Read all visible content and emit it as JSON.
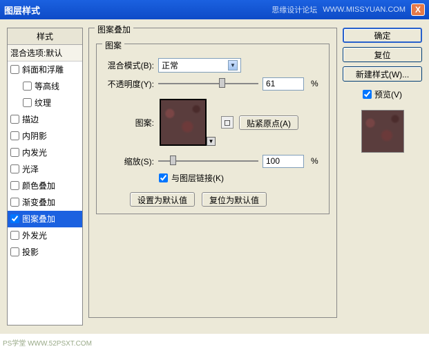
{
  "titlebar": {
    "title": "图层样式",
    "watermark1": "思缘设计论坛",
    "watermark2": "WWW.MISSYUAN.COM",
    "close": "X"
  },
  "styles_panel": {
    "header": "样式",
    "sub": "混合选项:默认",
    "items": [
      {
        "label": "斜面和浮雕",
        "checked": false,
        "indent": false
      },
      {
        "label": "等高线",
        "checked": false,
        "indent": true
      },
      {
        "label": "纹理",
        "checked": false,
        "indent": true
      },
      {
        "label": "描边",
        "checked": false,
        "indent": false
      },
      {
        "label": "内阴影",
        "checked": false,
        "indent": false
      },
      {
        "label": "内发光",
        "checked": false,
        "indent": false
      },
      {
        "label": "光泽",
        "checked": false,
        "indent": false
      },
      {
        "label": "颜色叠加",
        "checked": false,
        "indent": false
      },
      {
        "label": "渐变叠加",
        "checked": false,
        "indent": false
      },
      {
        "label": "图案叠加",
        "checked": true,
        "indent": false,
        "selected": true
      },
      {
        "label": "外发光",
        "checked": false,
        "indent": false
      },
      {
        "label": "投影",
        "checked": false,
        "indent": false
      }
    ]
  },
  "center": {
    "legend": "图案叠加",
    "inner_legend": "图案",
    "blend_label": "混合模式(B):",
    "blend_value": "正常",
    "opacity_label": "不透明度(Y):",
    "opacity_value": "61",
    "opacity_pct": "%",
    "pattern_label": "图案:",
    "snap_label": "贴紧原点(A)",
    "scale_label": "缩放(S):",
    "scale_value": "100",
    "scale_pct": "%",
    "link_label": "与图层链接(K)",
    "default_btn": "设置为默认值",
    "reset_btn": "复位为默认值"
  },
  "right": {
    "ok": "确定",
    "reset": "复位",
    "new_style": "新建样式(W)...",
    "preview_label": "预览(V)"
  },
  "footer": "PS学堂   WWW.52PSXT.COM"
}
